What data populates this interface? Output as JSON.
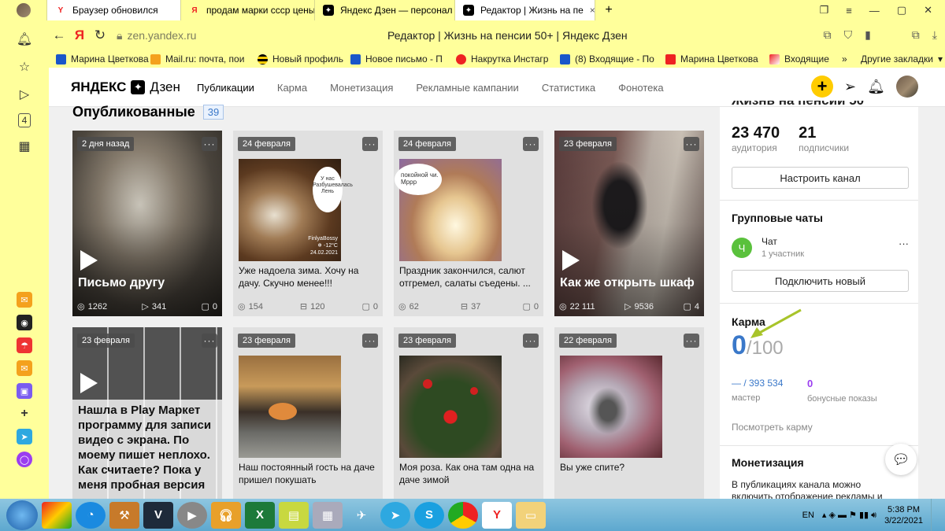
{
  "tabs": [
    {
      "label": "Браузер обновился",
      "fav": "Y",
      "color": "#fff",
      "fcolor": "#e22"
    },
    {
      "label": "продам марки ссср цены",
      "fav": "Я",
      "color": "#ffff9b",
      "fcolor": "#e22"
    },
    {
      "label": "Яндекс Дзен — персонал",
      "fav": "✦",
      "color": "#ffff9b",
      "fcolor": "#000"
    },
    {
      "label": "Редактор | Жизнь на пе",
      "fav": "✦",
      "color": "#fff",
      "fcolor": "#000"
    }
  ],
  "tab_close": "×",
  "new_tab": "+",
  "address": {
    "url": "zen.yandex.ru",
    "title": "Редактор | Жизнь на пенсии 50+ | Яндекс Дзен"
  },
  "bookmarks": [
    "Марина Цветкова",
    "Mail.ru: почта, пои",
    "Новый профиль",
    "Новое письмо - П",
    "Накрутка Инстагр",
    "(8) Входящие - По",
    "Марина Цветкова",
    "Входящие"
  ],
  "bookmarks_more": "»",
  "bookmarks_other": "Другие закладки",
  "zen": {
    "logo_main": "ЯНДЕКС",
    "logo_sub": "Дзен",
    "menu": [
      "Публикации",
      "Карма",
      "Монетизация",
      "Рекламные кампании",
      "Статистика",
      "Фонотека"
    ]
  },
  "published": {
    "title": "Опубликованные",
    "count": "39"
  },
  "cards": [
    {
      "date": "2 дня назад",
      "title": "Письмо другу",
      "views": "1262",
      "reads": "341",
      "comments": "0",
      "type": "video"
    },
    {
      "date": "24 февраля",
      "title": "Уже надоела зима. Хочу на дачу. Скучно менее!!!",
      "views": "154",
      "reads": "120",
      "comments": "0",
      "type": "article",
      "bubble": "У нас Разбушевалась Лень"
    },
    {
      "date": "24 февраля",
      "title": "Праздник закончился, салют отгремел, салаты съедены. ...",
      "views": "62",
      "reads": "37",
      "comments": "0",
      "type": "article",
      "bubble": "покойной чи. Мррр"
    },
    {
      "date": "23 февраля",
      "title": "Как же открыть шкаф",
      "views": "22 111",
      "reads": "9536",
      "comments": "4",
      "type": "video"
    },
    {
      "date": "23 февраля",
      "title": "Нашла в Play Маркет программу для записи видео с экрана. По моему пишет неплохо. Как считаете? Пока у меня пробная версия",
      "views": "",
      "reads": "",
      "comments": "",
      "type": "video"
    },
    {
      "date": "23 февраля",
      "title": "Наш постоянный гость на даче пришел покушать",
      "views": "",
      "reads": "",
      "comments": "",
      "type": "article"
    },
    {
      "date": "23 февраля",
      "title": "Моя роза. Как она там одна на даче зимой",
      "views": "",
      "reads": "",
      "comments": "",
      "type": "article"
    },
    {
      "date": "22 февраля",
      "title": "Вы уже спите?",
      "views": "",
      "reads": "",
      "comments": "",
      "type": "article"
    }
  ],
  "card_more": "···",
  "card_watermark": {
    "name": "FinlyaBossy",
    "temp": "-12°C",
    "date": "24.02.2021"
  },
  "sidebar": {
    "channel_title": "Жизнь на пенсии 50",
    "audience": "23 470",
    "audience_label": "аудитория",
    "subs": "21",
    "subs_label": "подписчики",
    "setup_btn": "Настроить канал",
    "chats_title": "Групповые чаты",
    "chat_letter": "Ч",
    "chat_name": "Чат",
    "chat_members": "1 участник",
    "chat_more": "···",
    "connect_btn": "Подключить новый",
    "karma_title": "Карма",
    "karma_value": "0",
    "karma_max": "/100",
    "master_value": "— / 393 534",
    "master_label": "мастер",
    "bonus_value": "0",
    "bonus_label": "бонусные показы",
    "karma_link": "Посмотреть карму",
    "monet_title": "Монетизация",
    "monet_text": "В публикациях канала можно включить отображение рекламы и"
  },
  "taskbar": {
    "lang": "EN",
    "time": "5:38 PM",
    "date": "3/22/2021"
  },
  "colors": {
    "browser": "#ffff9b",
    "accent": "#3a78c9",
    "zen_yellow": "#ffcc00",
    "green": "#5ac13c"
  }
}
